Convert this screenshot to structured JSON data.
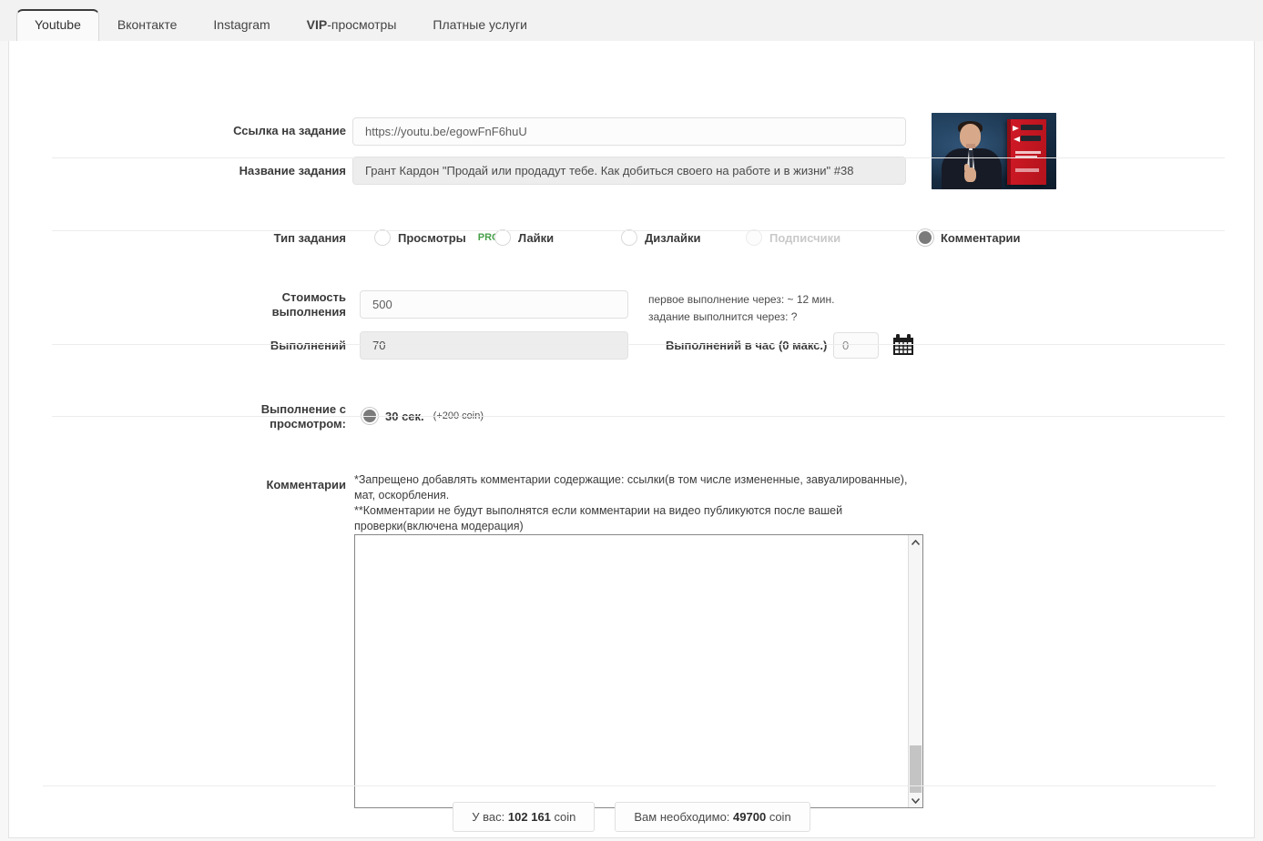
{
  "tabs": [
    {
      "label": "Youtube",
      "active": true
    },
    {
      "label": "Вконтакте",
      "active": false
    },
    {
      "label": "Instagram",
      "active": false
    },
    {
      "label": "VIP-просмотры",
      "active": false,
      "bold_prefix": "VIP",
      "rest": "-просмотры"
    },
    {
      "label": "Платные услуги",
      "active": false
    }
  ],
  "form": {
    "link_label": "Ссылка на задание",
    "link_value": "https://youtu.be/egowFnF6huU",
    "link_placeholder": "https://youtu.be/egowFnF6huU",
    "title_label": "Название задания",
    "title_value": "Грант Кардон \"Продай или продадут тебе. Как добиться своего на работе и в жизни\" #38",
    "title_placeholder": "Название задания"
  },
  "task_type": {
    "label": "Тип задания",
    "options": [
      {
        "label": "Просмотры",
        "badge": "PRO",
        "checked": false,
        "disabled": false
      },
      {
        "label": "Лайки",
        "badge": "",
        "checked": false,
        "disabled": false
      },
      {
        "label": "Дизлайки",
        "badge": "",
        "checked": false,
        "disabled": false
      },
      {
        "label": "Подписчики",
        "badge": "",
        "checked": false,
        "disabled": true
      },
      {
        "label": "Комментарии",
        "badge": "",
        "checked": true,
        "disabled": false
      }
    ]
  },
  "cost": {
    "cost_label": "Стоимость выполнения",
    "cost_value": "500",
    "count_label": "Выполнений",
    "count_value": "70",
    "per_hour_label": "Выполнений в час (0 макс.)",
    "per_hour_value": "0",
    "info_line1": "первое выполнение через: ~ 12 мин.",
    "info_line2": "задание выполнится через: ?"
  },
  "watch": {
    "label": "Выполнение с просмотром:",
    "option_label": "30 сек.",
    "option_bonus": "(+200 coin)",
    "checked": true
  },
  "comments": {
    "label": "Комментарии",
    "note_line1": "*Запрещено добавлять комментарии содержащие: ссылки(в том числе измененные, завуалированные),",
    "note_line2": "мат, оскорбления.",
    "note_line3": "**Комментарии не будут выполнятся если комментарии на видео публикуются после вашей",
    "note_line4": "проверки(включена модерация)",
    "textarea_value": "",
    "textarea_placeholder": ""
  },
  "footer": {
    "balance_prefix": "У вас:",
    "balance_amount": "102 161",
    "balance_suffix": "coin",
    "required_prefix": "Вам необходимо:",
    "required_amount": "49700",
    "required_suffix": "coin"
  },
  "colors": {
    "pro_green": "#46a049",
    "active_tab_border": "#3b3b3b",
    "panel_bg": "#ffffff",
    "page_bg": "#f2f2f2"
  },
  "icons": {
    "calendar": "calendar-icon",
    "scroll_up": "▲",
    "scroll_down": "▼"
  }
}
